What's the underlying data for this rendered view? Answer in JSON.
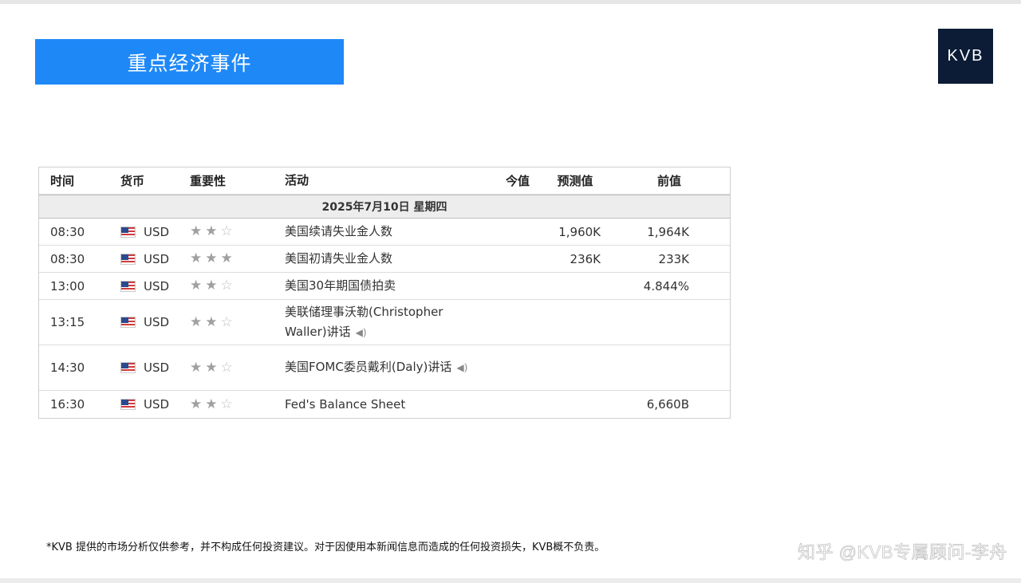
{
  "banner": {
    "title": "重点经济事件"
  },
  "logo": {
    "text": "KVB"
  },
  "table": {
    "headers": {
      "time": "时间",
      "currency": "货币",
      "importance": "重要性",
      "event": "活动",
      "actual": "今值",
      "forecast": "预测值",
      "previous": "前值"
    },
    "date": "2025年7月10日  星期四",
    "rows": [
      {
        "time": "08:30",
        "currency": "USD",
        "stars": 2,
        "event": "美国续请失业金人数",
        "audio": false,
        "actual": "",
        "forecast": "1,960K",
        "previous": "1,964K"
      },
      {
        "time": "08:30",
        "currency": "USD",
        "stars": 3,
        "event": "美国初请失业金人数",
        "audio": false,
        "actual": "",
        "forecast": "236K",
        "previous": "233K"
      },
      {
        "time": "13:00",
        "currency": "USD",
        "stars": 2,
        "event": "美国30年期国债拍卖",
        "audio": false,
        "actual": "",
        "forecast": "",
        "previous": "4.844%"
      },
      {
        "time": "13:15",
        "currency": "USD",
        "stars": 2,
        "event": "美联储理事沃勒(Christopher Waller)讲话",
        "audio": true,
        "actual": "",
        "forecast": "",
        "previous": ""
      },
      {
        "time": "14:30",
        "currency": "USD",
        "stars": 2,
        "event": "美国FOMC委员戴利(Daly)讲话",
        "audio": true,
        "actual": "",
        "forecast": "",
        "previous": ""
      },
      {
        "time": "16:30",
        "currency": "USD",
        "stars": 2,
        "event": "Fed's Balance Sheet",
        "audio": false,
        "actual": "",
        "forecast": "",
        "previous": "6,660B"
      }
    ]
  },
  "disclaimer": "*KVB 提供的市场分析仅供参考，并不构成任何投资建议。对于因使用本新闻信息而造成的任何投资损失，KVB概不负责。",
  "watermark": "知乎 @KVB专属顾问-李舟",
  "icons": {
    "flag": "us-flag-icon",
    "star": "star-icon",
    "audio": "speaker-icon"
  },
  "colors": {
    "banner": "#1e88f7",
    "logo_bg": "#0c1c36"
  }
}
